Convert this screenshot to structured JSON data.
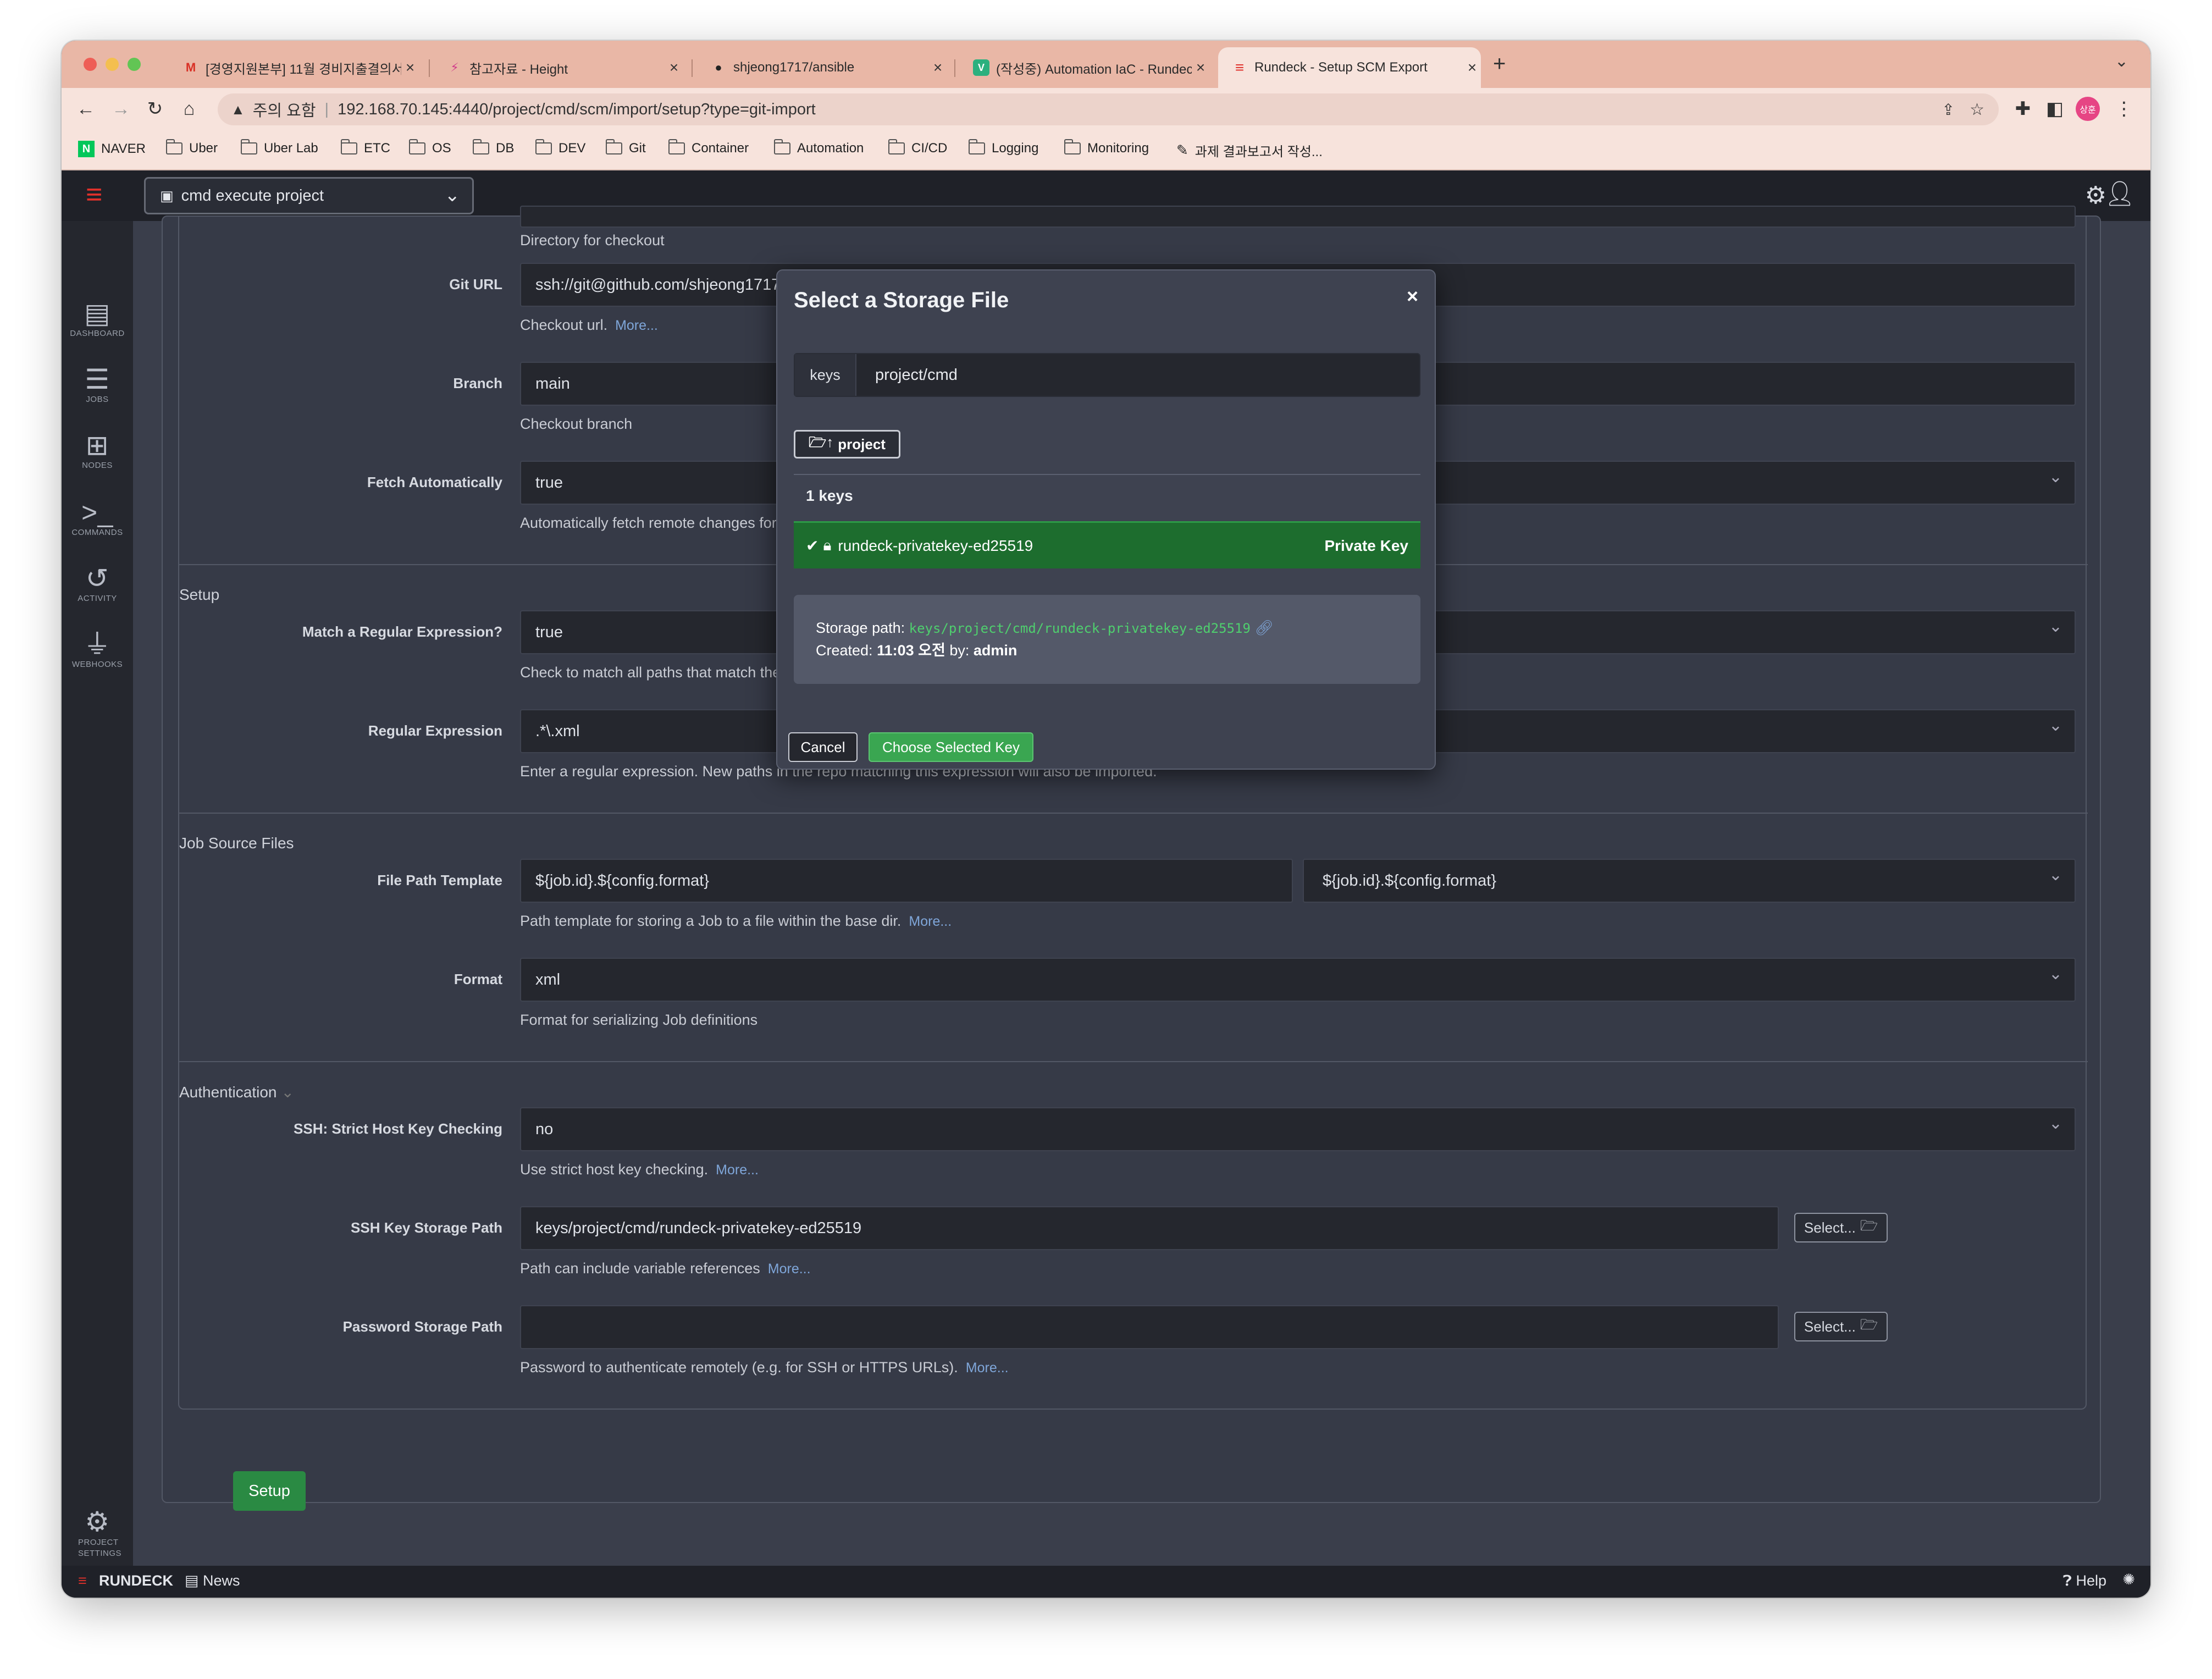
{
  "browser": {
    "tabs": [
      {
        "title": "[경영지원본부] 11월 경비지출결의서",
        "favicon": "M"
      },
      {
        "title": "참고자료 - Height",
        "favicon": "⚡"
      },
      {
        "title": "shjeong1717/ansible",
        "favicon": "●"
      },
      {
        "title": "(작성중) Automation IaC - Rundeck",
        "favicon": "V"
      },
      {
        "title": "Rundeck - Setup SCM Export",
        "favicon": "≡"
      }
    ],
    "security_label": "주의 요함",
    "url": "192.168.70.145:4440/project/cmd/scm/import/setup?type=git-import",
    "profile": "상훈",
    "bookmarks": [
      "NAVER",
      "Uber",
      "Uber Lab",
      "ETC",
      "OS",
      "DB",
      "DEV",
      "Git",
      "Container",
      "Automation",
      "CI/CD",
      "Logging",
      "Monitoring",
      "과제 결과보고서 작성..."
    ]
  },
  "app": {
    "project_selector": "cmd execute project",
    "sidebar": [
      {
        "label": "DASHBOARD",
        "icon": "clipboard-icon"
      },
      {
        "label": "JOBS",
        "icon": "list-icon"
      },
      {
        "label": "NODES",
        "icon": "sitemap-icon"
      },
      {
        "label": "COMMANDS",
        "icon": "terminal-icon"
      },
      {
        "label": "ACTIVITY",
        "icon": "history-icon"
      },
      {
        "label": "WEBHOOKS",
        "icon": "plug-icon"
      }
    ],
    "sidebar_bottom": "PROJECT SETTINGS"
  },
  "form": {
    "dir_help": "Directory for checkout",
    "git_url": {
      "label": "Git URL",
      "value": "ssh://git@github.com/shjeong1717/ansible.git",
      "help": "Checkout url.",
      "more": "More..."
    },
    "branch": {
      "label": "Branch",
      "value": "main",
      "help": "Checkout branch"
    },
    "fetch": {
      "label": "Fetch Automatically",
      "value": "true",
      "help": "Automatically fetch remote changes for local comparison. If false, you can perform it manually"
    },
    "setup_section": "Setup",
    "match_regex": {
      "label": "Match a Regular Expression?",
      "value": "true",
      "help": "Check to match all paths that match the regular expression."
    },
    "regex": {
      "label": "Regular Expression",
      "value": ".*\\.xml",
      "help": "Enter a regular expression. New paths in the repo matching this expression will also be imported."
    },
    "job_source_section": "Job Source Files",
    "file_path_template": {
      "label": "File Path Template",
      "value": "${job.id}.${config.format}",
      "select_value": "${job.id}.${config.format}",
      "help": "Path template for storing a Job to a file within the base dir.",
      "more": "More..."
    },
    "format": {
      "label": "Format",
      "value": "xml",
      "help": "Format for serializing Job definitions"
    },
    "auth_section": "Authentication",
    "strict_host": {
      "label": "SSH: Strict Host Key Checking",
      "value": "no",
      "help": "Use strict host key checking.",
      "more": "More..."
    },
    "ssh_key_path": {
      "label": "SSH Key Storage Path",
      "value": "keys/project/cmd/rundeck-privatekey-ed25519",
      "help": "Path can include variable references",
      "more": "More...",
      "select": "Select..."
    },
    "password_path": {
      "label": "Password Storage Path",
      "value": "",
      "help": "Password to authenticate remotely (e.g. for SSH or HTTPS URLs).",
      "more": "More...",
      "select": "Select..."
    },
    "setup_button": "Setup"
  },
  "modal": {
    "title": "Select a Storage File",
    "close": "×",
    "path_prefix": "keys",
    "path_value": "project/cmd",
    "up_button": "project",
    "count": "1 keys",
    "key_name": "rundeck-privatekey-ed25519",
    "key_type": "Private Key",
    "storage_path_label": "Storage path:",
    "storage_path": "keys/project/cmd/rundeck-privatekey-ed25519",
    "created_label": "Created:",
    "created_value": "11:03 오전",
    "by_label": "by:",
    "by_value": "admin",
    "cancel": "Cancel",
    "choose": "Choose Selected Key"
  },
  "footer": {
    "brand": "RUNDECK",
    "news": "News",
    "help": "Help"
  },
  "colors": {
    "accent_green": "#1d6d2e",
    "brand_red": "#e0312b",
    "tab_bar": "#e9b7a6"
  }
}
